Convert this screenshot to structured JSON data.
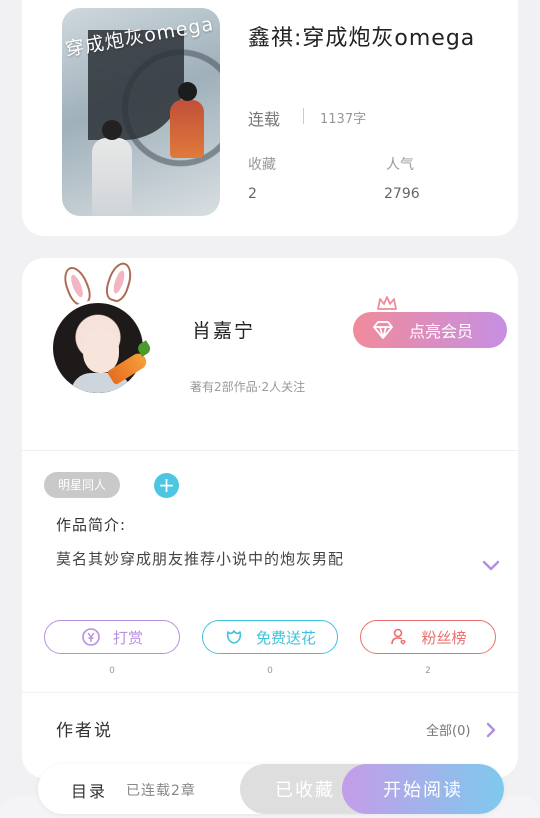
{
  "book": {
    "cover_title": "穿成炮灰omega",
    "title": "鑫祺:穿成炮灰omega",
    "status": "连载",
    "word_count": "1137字",
    "collect_label": "收藏",
    "collect_value": "2",
    "popularity_label": "人气",
    "popularity_value": "2796"
  },
  "author": {
    "name": "肖嘉宁",
    "meta": "著有2部作品·2人关注",
    "vip_button": "点亮会员"
  },
  "tag": "明星同人",
  "intro": {
    "label": "作品简介:",
    "text": "莫名其妙穿成朋友推荐小说中的炮灰男配"
  },
  "actions": [
    {
      "label": "打赏",
      "count": "0",
      "color": "#b98fe0",
      "icon": "yen-coin-icon"
    },
    {
      "label": "免费送花",
      "count": "0",
      "color": "#3fc3dc",
      "icon": "flower-icon"
    },
    {
      "label": "粉丝榜",
      "count": "2",
      "color": "#ec6f6f",
      "icon": "fan-ranking-icon"
    }
  ],
  "author_says": {
    "label": "作者说",
    "all": "全部(0)"
  },
  "bottom_bar": {
    "toc": "目录",
    "toc_sub": "已连载2章",
    "collected": "已收藏",
    "start_reading": "开始阅读"
  }
}
